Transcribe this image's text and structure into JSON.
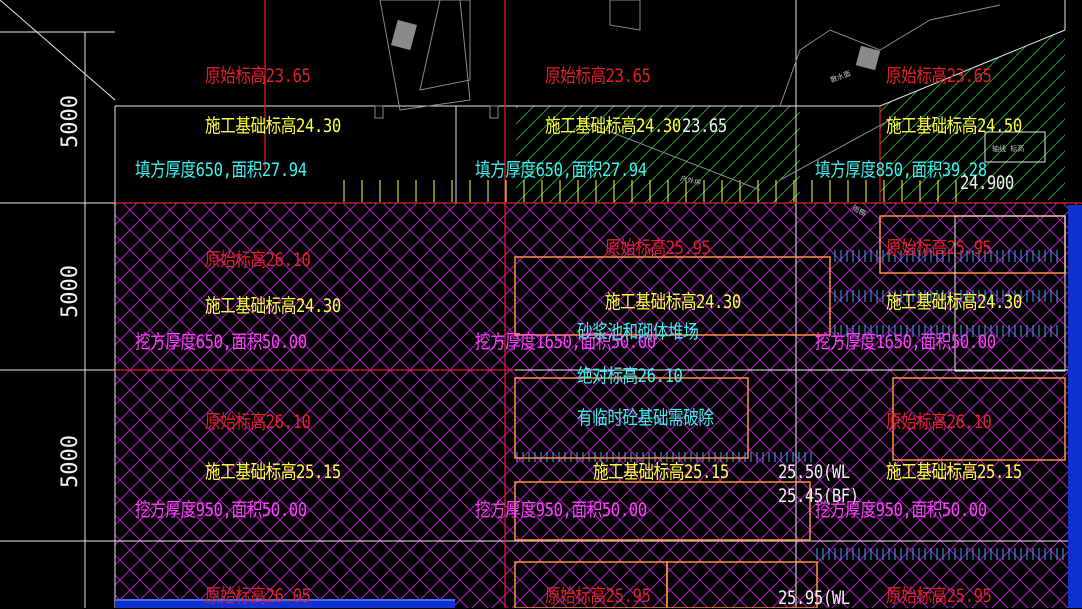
{
  "drawing": {
    "dimensions": [
      "5000",
      "5000",
      "5000"
    ],
    "row1": {
      "cell1": {
        "orig": "原始标高23.65",
        "const": "施工基础标高24.30",
        "work": "填方厚度650,面积27.94"
      },
      "cell2": {
        "orig": "原始标高23.65",
        "const": "施工基础标高24.30",
        "extra": "23.65",
        "work": "填方厚度650,面积27.94"
      },
      "cell3": {
        "orig": "原始标高23.65",
        "const": "施工基础标高24.50",
        "work": "填方厚度850,面积39.28",
        "level": "24.900"
      }
    },
    "row2": {
      "cell1": {
        "orig": "原始标高26.10",
        "const": "施工基础标高24.30",
        "work": "挖方厚度650,面积50.00"
      },
      "cell2": {
        "orig": "原始标高25.95",
        "const": "施工基础标高24.30",
        "work": "挖方厚度1650,面积50.00"
      },
      "cell3": {
        "orig": "原始标高25.95",
        "const": "施工基础标高24.30",
        "work": "挖方厚度1650,面积50.00"
      },
      "note1": "砂浆池和砌体堆场",
      "note2": "绝对标高26.10",
      "note3": "有临时砼基础需破除"
    },
    "row3": {
      "cell1": {
        "orig": "原始标高26.10",
        "const": "施工基础标高25.15",
        "work": "挖方厚度950,面积50.00"
      },
      "cell2": {
        "const": "施工基础标高25.15",
        "work": "挖方厚度950,面积50.00"
      },
      "cell3": {
        "orig": "原始标高26.10",
        "const": "施工基础标高25.15",
        "work": "挖方厚度950,面积50.00"
      },
      "wl": "25.50(WL",
      "bf": "25.45(BF)"
    },
    "row4": {
      "cell1": {
        "orig": "原始标高26.05"
      },
      "cell2": {
        "orig": "原始标高25.95"
      },
      "cell3": {
        "orig": "原始标高25.95"
      },
      "wl": "25.95(WL"
    },
    "small_labels": {
      "a": "散水面",
      "b": "户外坪",
      "c": "雨棚",
      "d": "轴线 标高"
    },
    "colors": {
      "background": "#000000",
      "grid": "#ffffff",
      "original_elevation": "#e0202a",
      "construction_elevation": "#ffff40",
      "fill": "#40f0f0",
      "cut": "#ff40ff",
      "hatch_cut": "#b020c0",
      "hatch_fill": "#20a030",
      "boundary": "#ff9040",
      "water": "#2050ff"
    }
  }
}
